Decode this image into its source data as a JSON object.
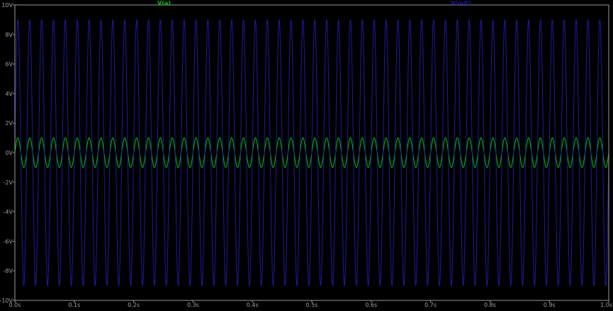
{
  "chart_data": {
    "type": "line",
    "title": "",
    "xlabel": "",
    "ylabel": "",
    "xlim": [
      0.0,
      1.0
    ],
    "ylim": [
      -10,
      10
    ],
    "grid": false,
    "legend_placement": "top",
    "x_ticks": [
      "0.0s",
      "0.1s",
      "0.2s",
      "0.3s",
      "0.4s",
      "0.5s",
      "0.6s",
      "0.7s",
      "0.8s",
      "0.9s",
      "1.0s"
    ],
    "y_ticks": [
      "10V",
      "8V",
      "6V",
      "4V",
      "2V",
      "0V",
      "-2V",
      "-4V",
      "-6V",
      "-8V",
      "-10V"
    ],
    "y_tick_values": [
      10,
      8,
      6,
      4,
      2,
      0,
      -2,
      -4,
      -6,
      -8,
      -10
    ],
    "x_tick_values": [
      0.0,
      0.1,
      0.2,
      0.3,
      0.4,
      0.5,
      0.6,
      0.7,
      0.8,
      0.9,
      1.0
    ],
    "series": [
      {
        "name": "V(a)",
        "color": "#00c800",
        "waveform": "sine",
        "amplitude": 1,
        "frequency": 50,
        "offset": 0
      },
      {
        "name": "V(out)",
        "color": "#1c1ca0",
        "waveform": "sine",
        "amplitude": 9,
        "frequency": 50,
        "offset": 0
      }
    ]
  },
  "colors": {
    "background": "#000000",
    "frame": "#9a9a9a",
    "tick_text": "#a0a0a0"
  }
}
